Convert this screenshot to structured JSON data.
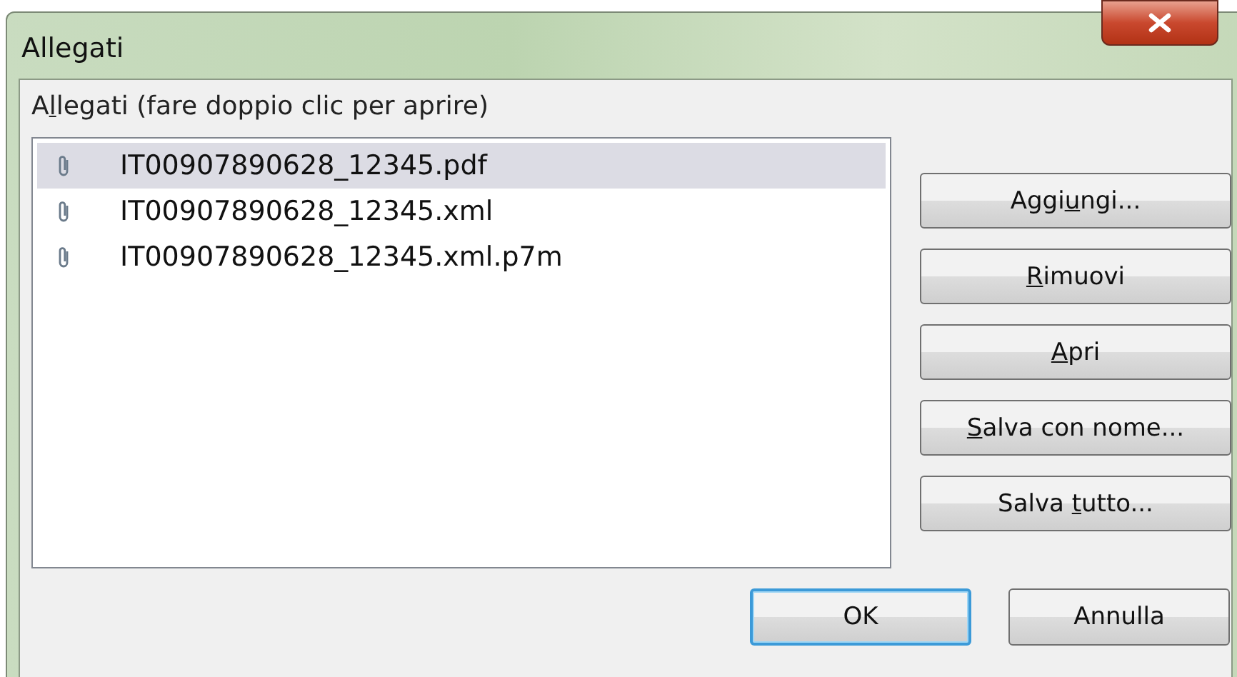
{
  "window": {
    "title": "Allegati"
  },
  "list_label": {
    "pre": "A",
    "key": "l",
    "post": "legati (fare doppio clic per aprire)"
  },
  "attachments": [
    {
      "name": "IT00907890628_12345.pdf",
      "selected": true
    },
    {
      "name": "IT00907890628_12345.xml",
      "selected": false
    },
    {
      "name": "IT00907890628_12345.xml.p7m",
      "selected": false
    }
  ],
  "side_buttons": [
    {
      "pre": "Aggi",
      "key": "u",
      "post": "ngi..."
    },
    {
      "key": "R",
      "post": "imuovi"
    },
    {
      "key": "A",
      "post": "pri"
    },
    {
      "key": "S",
      "post": "alva con nome..."
    },
    {
      "pre": "Salva ",
      "key": "t",
      "post": "utto..."
    }
  ],
  "dialog_buttons": [
    {
      "label": "OK",
      "default": true
    },
    {
      "label": "Annulla",
      "default": false
    }
  ]
}
